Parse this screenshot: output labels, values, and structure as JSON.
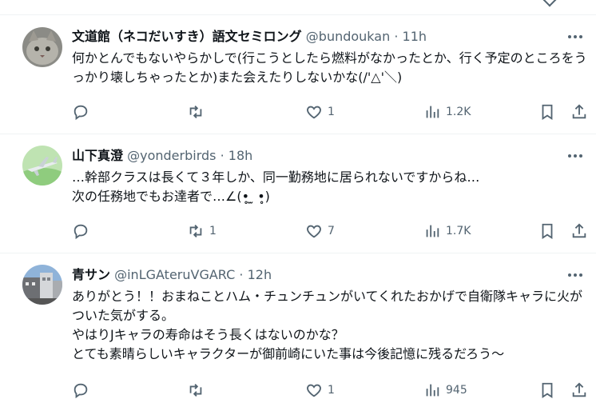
{
  "tweets": [
    {
      "name": "文道館（ネコだいすき）語文セミロング",
      "handle": "@bundoukan",
      "sep": "·",
      "time": "11h",
      "text": "何かとんでもないやらかしで(行こうとしたら燃料がなかったとか、行く予定のところをうっかり壊しちゃったとか)また会えたりしないかな(/'△'＼)",
      "replies": "",
      "reposts": "",
      "likes": "1",
      "views": "1.2K"
    },
    {
      "name": "山下真澄",
      "handle": "@yonderbirds",
      "sep": "·",
      "time": "18h",
      "text": "…幹部クラスは長くて３年しか、同一勤務地に居られないですからね…\n次の任務地でもお達者で…∠(•̥ ̫ •̥)",
      "replies": "",
      "reposts": "1",
      "likes": "7",
      "views": "1.7K"
    },
    {
      "name": "青サン",
      "handle": "@inLGAteruVGARC",
      "sep": "·",
      "time": "12h",
      "text": "ありがとう！！おまねことハム・チュンチュンがいてくれたおかげで自衛隊キャラに火がついた気がする。\nやはりJキャラの寿命はそう長くはないのかな？\nとても素晴らしいキャラクターが御前崎にいた事は今後記憶に残るだろう～",
      "replies": "",
      "reposts": "",
      "likes": "1",
      "views": "945"
    }
  ],
  "icons": [
    "reply-icon",
    "repost-icon",
    "like-icon",
    "views-icon",
    "bookmark-icon",
    "share-icon",
    "more-icon"
  ]
}
